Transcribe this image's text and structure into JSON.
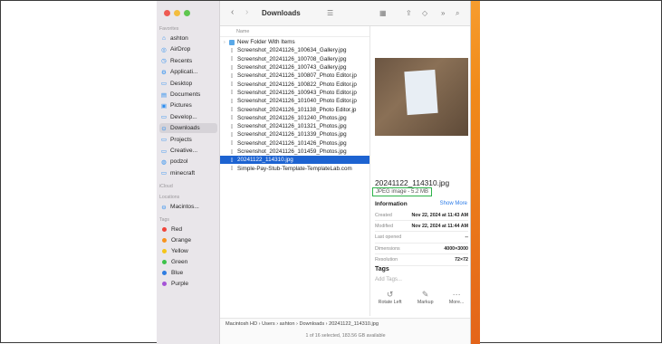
{
  "window": {
    "title": "Downloads"
  },
  "sidebar": {
    "favorites_header": "Favorites",
    "favorites": [
      {
        "label": "ashton",
        "icon": "home-icon"
      },
      {
        "label": "AirDrop",
        "icon": "airdrop-icon"
      },
      {
        "label": "Recents",
        "icon": "clock-icon"
      },
      {
        "label": "Applicati...",
        "icon": "applications-icon"
      },
      {
        "label": "Desktop",
        "icon": "desktop-icon"
      },
      {
        "label": "Documents",
        "icon": "document-icon"
      },
      {
        "label": "Pictures",
        "icon": "pictures-icon"
      },
      {
        "label": "Develop...",
        "icon": "folder-icon"
      },
      {
        "label": "Downloads",
        "icon": "download-icon",
        "selected": true
      },
      {
        "label": "Projects",
        "icon": "folder-icon"
      },
      {
        "label": "Creative...",
        "icon": "folder-icon"
      },
      {
        "label": "podzol",
        "icon": "globe-icon"
      },
      {
        "label": "minecraft",
        "icon": "folder-icon"
      }
    ],
    "icloud_header": "iCloud",
    "locations_header": "Locations",
    "locations": [
      {
        "label": "Macintos...",
        "icon": "disk-icon"
      }
    ],
    "tags_header": "Tags",
    "tags": [
      {
        "label": "Red",
        "color": "#f0443a"
      },
      {
        "label": "Orange",
        "color": "#f7931e"
      },
      {
        "label": "Yellow",
        "color": "#f5c518"
      },
      {
        "label": "Green",
        "color": "#3cc24a"
      },
      {
        "label": "Blue",
        "color": "#2f7de1"
      },
      {
        "label": "Purple",
        "color": "#a553d6"
      }
    ]
  },
  "list": {
    "column_header": "Name",
    "files": [
      {
        "name": "New Folder With Items",
        "icon": "folder-icon",
        "folder": true
      },
      {
        "name": "Screenshot_20241126_100634_Gallery.jpg"
      },
      {
        "name": "Screenshot_20241126_100708_Gallery.jpg"
      },
      {
        "name": "Screenshot_20241126_100743_Gallery.jpg"
      },
      {
        "name": "Screenshot_20241126_100807_Photo Editor.jp"
      },
      {
        "name": "Screenshot_20241126_100822_Photo Editor.jp"
      },
      {
        "name": "Screenshot_20241126_100943_Photo Editor.jp"
      },
      {
        "name": "Screenshot_20241126_101040_Photo Editor.jp"
      },
      {
        "name": "Screenshot_20241126_101138_Photo Editor.jp"
      },
      {
        "name": "Screenshot_20241126_101240_Photos.jpg"
      },
      {
        "name": "Screenshot_20241126_101321_Photos.jpg"
      },
      {
        "name": "Screenshot_20241126_101339_Photos.jpg"
      },
      {
        "name": "Screenshot_20241126_101426_Photos.jpg"
      },
      {
        "name": "Screenshot_20241126_101459_Photos.jpg"
      },
      {
        "name": "20241122_114310.jpg",
        "selected": true
      },
      {
        "name": "Simple-Pay-Stub-Template-TemplateLab.com"
      }
    ]
  },
  "preview": {
    "filename": "20241122_114310.jpg",
    "type_size": "JPEG image - 5.2 MB",
    "info_header": "Information",
    "show_more": "Show More",
    "rows": [
      {
        "key": "Created",
        "value": "Nov 22, 2024 at 11:43 AM"
      },
      {
        "key": "Modified",
        "value": "Nov 22, 2024 at 11:44 AM"
      },
      {
        "key": "Last opened",
        "value": "--"
      },
      {
        "key": "Dimensions",
        "value": "4000×3000"
      },
      {
        "key": "Resolution",
        "value": "72×72"
      }
    ],
    "tags_header": "Tags",
    "add_tags": "Add Tags...",
    "actions": [
      {
        "label": "Rotate Left",
        "icon": "rotate-left-icon",
        "glyph": "↺"
      },
      {
        "label": "Markup",
        "icon": "markup-icon",
        "glyph": "✎"
      },
      {
        "label": "More...",
        "icon": "more-icon",
        "glyph": "⋯"
      }
    ]
  },
  "pathbar": "Macintosh HD › Users › ashton › Downloads › 20241122_114310.jpg",
  "status": "1 of 16 selected, 183.56 GB available"
}
